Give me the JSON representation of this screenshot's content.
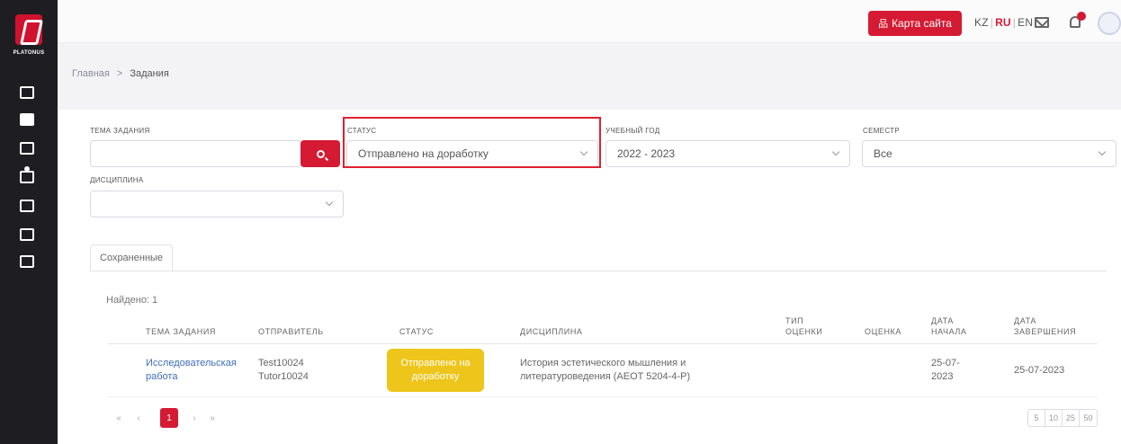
{
  "brand": {
    "logo_text": "PLATONUS"
  },
  "header": {
    "sitemap_label": "Карта сайта",
    "lang_kz": "KZ",
    "lang_ru": "RU",
    "lang_en": "EN",
    "active_lang": "RU"
  },
  "breadcrumb": {
    "home": "Главная",
    "sep": ">",
    "current": "Задания"
  },
  "filters": {
    "topic_label": "ТЕМА ЗАДАНИЯ",
    "topic_value": "",
    "status_label": "СТАТУС",
    "status_value": "Отправлено на доработку",
    "year_label": "УЧЕБНЫЙ ГОД",
    "year_value": "2022 - 2023",
    "semester_label": "СЕМЕСТР",
    "semester_value": "Все",
    "discipline_label": "ДИСЦИПЛИНА",
    "discipline_value": ""
  },
  "tabs": {
    "saved": "Сохраненные"
  },
  "results": {
    "found": "Найдено: 1"
  },
  "table": {
    "headers": {
      "topic": "ТЕМА ЗАДАНИЯ",
      "sender": "ОТПРАВИТЕЛЬ",
      "status": "СТАТУС",
      "discipline": "ДИСЦИПЛИНА",
      "grade_type_1": "ТИП",
      "grade_type_2": "ОЦЕНКИ",
      "grade": "ОЦЕНКА",
      "start_1": "ДАТА",
      "start_2": "НАЧАЛА",
      "end_1": "ДАТА",
      "end_2": "ЗАВЕРШЕНИЯ"
    },
    "rows": [
      {
        "topic_1": "Исследовательская",
        "topic_2": "работа",
        "sender_1": "Test10024",
        "sender_2": "Tutor10024",
        "status_1": "Отправлено на",
        "status_2": "доработку",
        "discipline_1": "История эстетического мышления и",
        "discipline_2": "литературоведения (AEOT 5204-4-P)",
        "grade_type": "",
        "grade": "",
        "start_1": "25-07-",
        "start_2": "2023",
        "end": "25-07-2023"
      }
    ]
  },
  "pagination": {
    "first": "«",
    "prev": "‹",
    "page": "1",
    "next": "›",
    "last": "»",
    "sizes": [
      "5",
      "10",
      "25",
      "50"
    ]
  },
  "colors": {
    "accent": "#d51a33",
    "badge": "#eec51a",
    "sidebar": "#1e1e22",
    "link": "#3f6dbf"
  }
}
